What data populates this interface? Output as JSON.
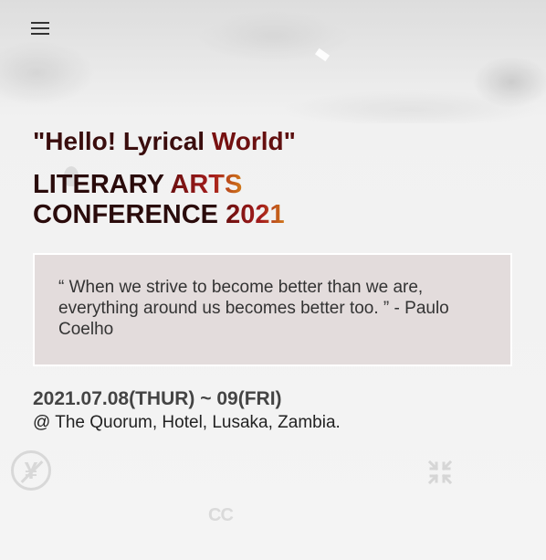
{
  "header": {
    "menu_icon": "hamburger-menu-icon"
  },
  "hero": {
    "title_prefix": "\"Hello! Lyrical ",
    "title_highlight": "World\"",
    "heading_line1_a": "LITERARY ",
    "heading_line1_b": "ARTS",
    "heading_line2_a": "CONFERENCE ",
    "heading_line2_b": "2021"
  },
  "quote": {
    "text": "“ When we strive to become better than we are, everything around us becomes better too. ” - Paulo Coelho"
  },
  "event": {
    "date": "2021.07.08(THUR) ~ 09(FRI)",
    "venue": "@ The Quorum, Hotel, Lusaka, Zambia."
  },
  "overlay_icons": {
    "yen_icon": "no-yen-icon",
    "shrink_icon": "exit-fullscreen-icon",
    "cc_icon": "closed-captions-icon",
    "cc_text": "CC"
  },
  "colors": {
    "title": "#3a0d0d",
    "accent_start": "#6b1010",
    "accent_end": "#d17a1a",
    "quote_bg": "#e3dcdc",
    "date": "#444444"
  }
}
